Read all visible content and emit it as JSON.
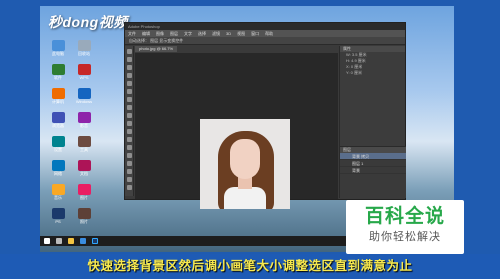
{
  "logo": {
    "text": "秒dong视频"
  },
  "desktop": {
    "icons": [
      {
        "label": "此电脑",
        "color": "#4a90d9"
      },
      {
        "label": "回收站",
        "color": "#9ab"
      },
      {
        "label": "软件",
        "color": "#2e7d32"
      },
      {
        "label": "WPS",
        "color": "#c62828"
      },
      {
        "label": "计算机",
        "color": "#ef6c00"
      },
      {
        "label": "Windows",
        "color": "#1565c0"
      },
      {
        "label": "浏览器",
        "color": "#3f51b5"
      },
      {
        "label": "影音",
        "color": "#8e24aa"
      },
      {
        "label": "设置",
        "color": "#00838f"
      },
      {
        "label": "工具",
        "color": "#6d4c41"
      },
      {
        "label": "网络",
        "color": "#0277bd"
      },
      {
        "label": "文档",
        "color": "#ad1457"
      },
      {
        "label": "音乐",
        "color": "#f9a825"
      },
      {
        "label": "图片",
        "color": "#e91e63"
      },
      {
        "label": "PS",
        "color": "#1b3a6b"
      },
      {
        "label": "照片",
        "color": "#5d4037"
      }
    ]
  },
  "photoshop": {
    "title": "Adobe Photoshop",
    "menu": [
      "文件",
      "编辑",
      "图像",
      "图层",
      "文字",
      "选择",
      "滤镜",
      "3D",
      "视图",
      "窗口",
      "帮助"
    ],
    "options_text": "自动选择： 图层  显示变换控件",
    "tab": "photo.jpg @ 66.7%",
    "panel_title": "属性",
    "props": [
      "W: 3.5 厘米",
      "H: 4.9 厘米",
      "X: 0 厘米",
      "Y: 0 厘米"
    ],
    "layers_title": "图层",
    "layers": [
      "背景 拷贝",
      "图层 1",
      "背景"
    ]
  },
  "brand": {
    "title": "百科全说",
    "subtitle": "助你轻松解决"
  },
  "subtitle": "快速选择背景区然后调小画笔大小调整选区直到满意为止"
}
